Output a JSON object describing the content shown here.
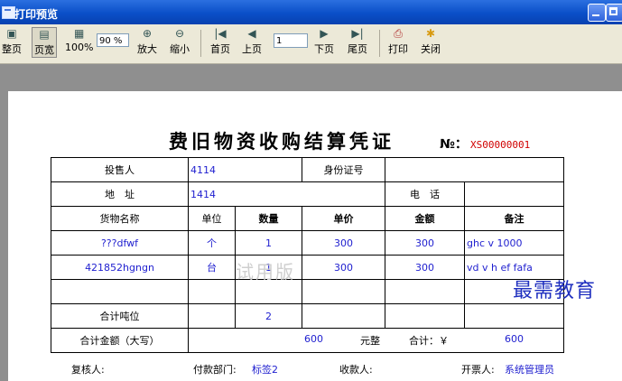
{
  "window": {
    "title": "打印预览"
  },
  "toolbar": {
    "whole_page": "整页",
    "page_width": "页宽",
    "hundred": "100%",
    "zoom_value": "90 %",
    "zoom_in": "放大",
    "zoom_out": "缩小",
    "first_page": "首页",
    "prev_page": "上页",
    "page_num": "1",
    "next_page": "下页",
    "last_page": "尾页",
    "print": "打印",
    "close": "关闭"
  },
  "voucher": {
    "title": "费旧物资收购结算凭证",
    "no_label": "№：",
    "no_value": "XS00000001",
    "seller_label": "投售人",
    "seller_value": "4114",
    "id_label": "身份证号",
    "id_value": "",
    "address_label": "地　址",
    "address_value": "1414",
    "phone_label": "电　话",
    "phone_value": "",
    "headers": [
      "货物名称",
      "单位",
      "数量",
      "单价",
      "金额",
      "备注"
    ],
    "rows": [
      {
        "name": "???dfwf",
        "unit": "个",
        "qty": "1",
        "price": "300",
        "amount": "300",
        "remark": "ghc v 1000"
      },
      {
        "name": "421852hgngn",
        "unit": "台",
        "qty": "1",
        "price": "300",
        "amount": "300",
        "remark": "vd v h ef fafa"
      }
    ],
    "total_tons_label": "合计吨位",
    "total_tons_value": "2",
    "total_amount_label": "合计金额（大写）",
    "total_amount_value": "600",
    "yuan_label": "元整",
    "total_label": "合计：￥",
    "total_value": "600",
    "watermark": "试用版"
  },
  "footer": {
    "reviewer_label": "复核人:",
    "dept_label": "付款部门:",
    "dept_value": "标签2",
    "payee_label": "收款人:",
    "drawer_label": "开票人:",
    "drawer_value": "系统管理员"
  },
  "brand_watermark": "最需教育"
}
